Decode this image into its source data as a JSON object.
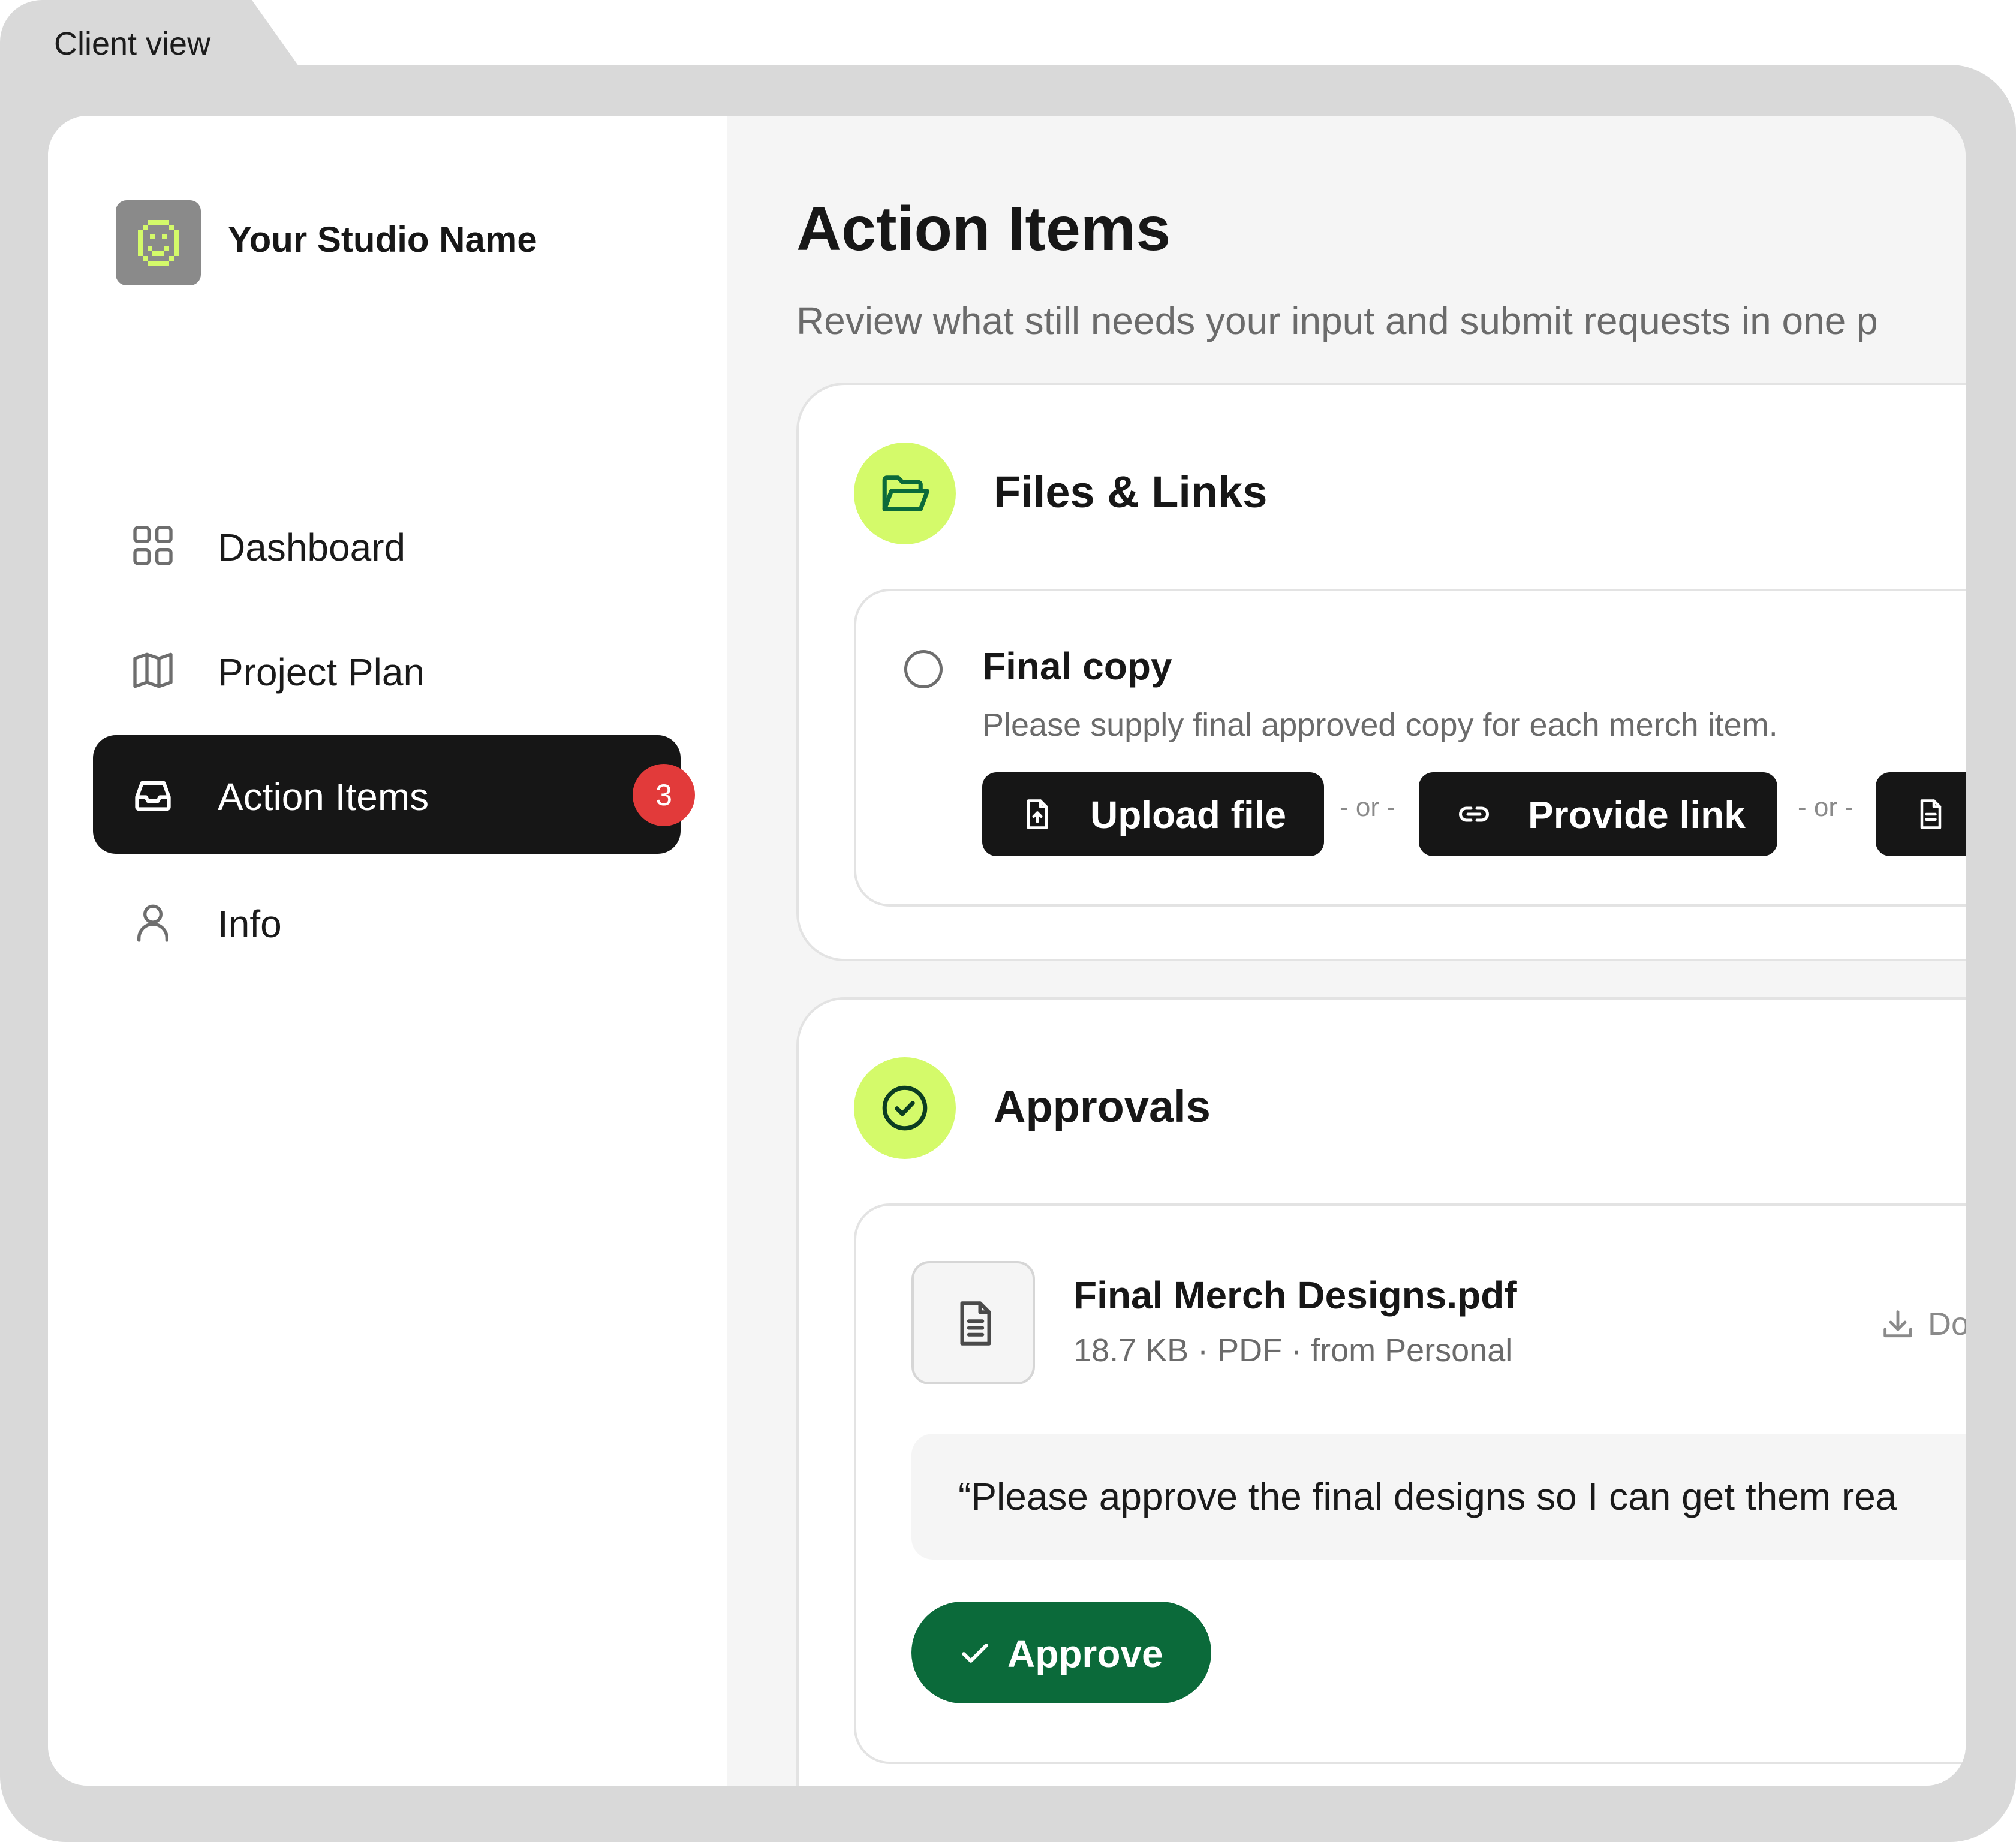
{
  "tab": {
    "label": "Client view"
  },
  "brand": {
    "name": "Your Studio Name",
    "icon": "pixel-smiley-icon"
  },
  "sidebar": {
    "items": [
      {
        "label": "Dashboard",
        "icon": "grid-icon",
        "active": false
      },
      {
        "label": "Project Plan",
        "icon": "map-icon",
        "active": false
      },
      {
        "label": "Action Items",
        "icon": "inbox-icon",
        "active": true,
        "badge": "3"
      },
      {
        "label": "Info",
        "icon": "user-icon",
        "active": false
      }
    ]
  },
  "main": {
    "title": "Action Items",
    "subtitle": "Review what still needs your input and submit requests in one p"
  },
  "files_section": {
    "title": "Files & Links",
    "icon": "folder-open-icon",
    "task": {
      "title": "Final copy",
      "description": "Please supply final approved copy for each merch item.",
      "upload_label": "Upload file",
      "link_label": "Provide link",
      "separator": "- or -",
      "third_action_icon": "document-icon"
    }
  },
  "approvals_section": {
    "title": "Approvals",
    "icon": "check-circle-icon",
    "file": {
      "name": "Final Merch Designs.pdf",
      "meta": "18.7 KB · PDF · from Personal",
      "download_label": "Do"
    },
    "quote": "“Please approve the final designs so I can get them rea",
    "approve_label": "Approve"
  },
  "colors": {
    "accent_lime": "#d4fa6a",
    "approve_green": "#0b6a3a",
    "badge_red": "#e23a3a",
    "dark": "#161616"
  }
}
